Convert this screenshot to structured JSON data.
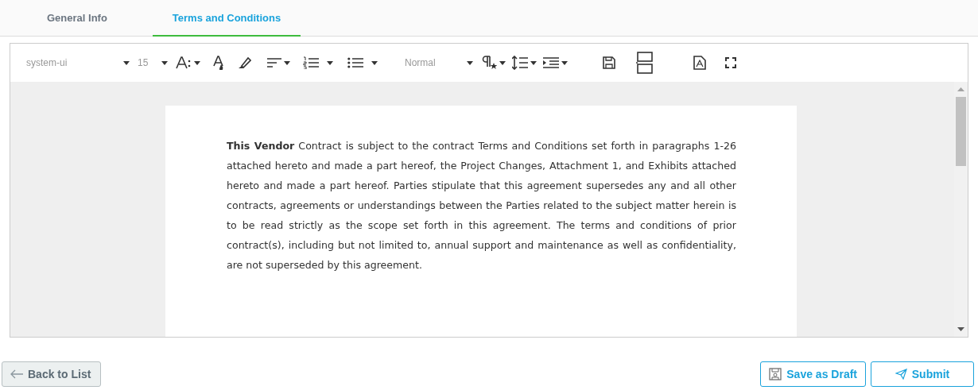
{
  "tabs": [
    {
      "label": "General Info",
      "selected": false
    },
    {
      "label": "Terms and Conditions",
      "selected": true
    }
  ],
  "toolbar": {
    "font": "system-ui",
    "size": "15",
    "style": "Normal"
  },
  "document": {
    "paragraph": "**This Vendor** Contract is subject to the contract Terms and Conditions set forth in paragraphs 1-26 attached hereto and made a part hereof, the Project Changes, Attachment 1, and Exhibits attached hereto and made a part hereof. Parties stipulate that this agreement supersedes any and all other contracts, agreements or understandings between the Parties related to the subject matter herein is to be read strictly as the scope set forth in this agreement. The terms and conditions of prior contract(s), including but not limited to, annual support and maintenance as well as confidentiality, are not superseded by this agreement."
  },
  "buttons": {
    "back": "Back to List",
    "draft": "Save as Draft",
    "submit": "Submit"
  }
}
